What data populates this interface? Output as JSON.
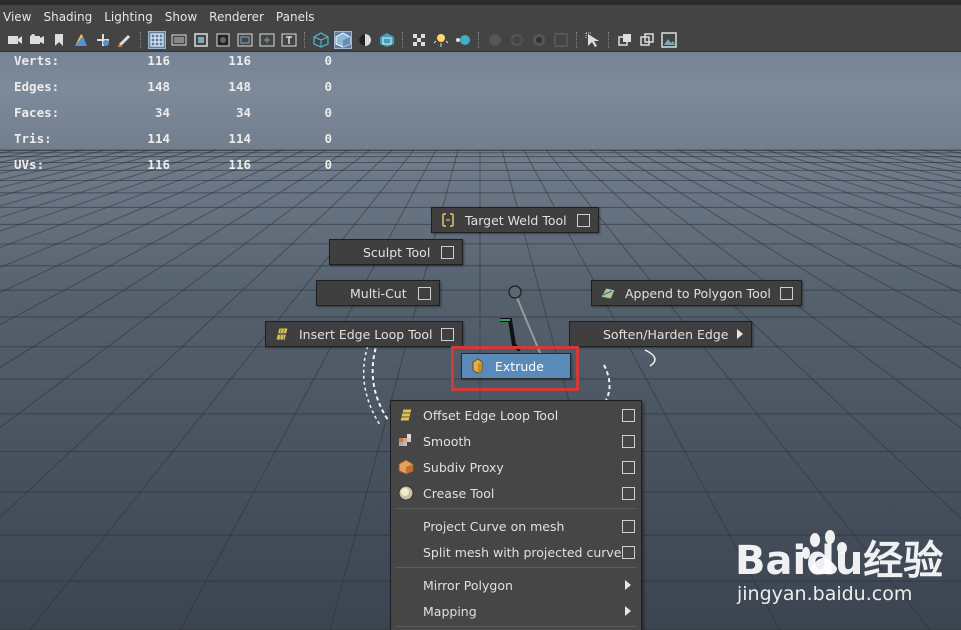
{
  "menubar": {
    "items": [
      "View",
      "Shading",
      "Lighting",
      "Show",
      "Renderer",
      "Panels"
    ]
  },
  "toolbar": {
    "icons": [
      "select-camera-icon",
      "camera-attributes-icon",
      "bookmark-icon",
      "image-plane-icon",
      "2d-pan-zoom-icon",
      "grease-pencil-icon",
      "grid-icon",
      "film-gate-icon",
      "resolution-gate-icon",
      "gate-mask-icon",
      "field-chart-icon",
      "safe-action-icon",
      "safe-title-icon",
      "wireframe-icon",
      "smooth-shade-all-icon",
      "default-material-icon",
      "textured-icon",
      "use-all-lights-icon",
      "shadows-icon",
      "screen-space-ao-icon",
      "motion-blur-icon",
      "anti-aliasing-icon",
      "depth-of-field-icon",
      "isolate-select-icon",
      "xray-icon",
      "xray-joints-icon",
      "backface-culling-icon"
    ]
  },
  "hud": {
    "rows": [
      {
        "label": "Verts:",
        "v1": "116",
        "v2": "116",
        "v3": "0"
      },
      {
        "label": "Edges:",
        "v1": "148",
        "v2": "148",
        "v3": "0"
      },
      {
        "label": "Faces:",
        "v1": "34",
        "v2": "34",
        "v3": "0"
      },
      {
        "label": "Tris:",
        "v1": "114",
        "v2": "114",
        "v3": "0"
      },
      {
        "label": "UVs:",
        "v1": "116",
        "v2": "116",
        "v3": "0"
      }
    ]
  },
  "marking_menu": {
    "north": "Target Weld Tool",
    "northwest_upper": "Sculpt Tool",
    "west": "Multi-Cut",
    "east": "Append to Polygon Tool",
    "southwest": "Insert Edge Loop Tool",
    "southeast": "Soften/Harden Edge",
    "south": "Extrude"
  },
  "dropdown": {
    "group1": [
      "Offset Edge Loop Tool",
      "Smooth",
      "Subdiv Proxy",
      "Crease Tool"
    ],
    "group2": [
      "Project Curve on mesh",
      "Split mesh with projected curve"
    ],
    "group3": [
      "Mirror Polygon",
      "Mapping"
    ]
  },
  "watermark": {
    "brand": "Baidu经验",
    "url": "jingyan.baidu.com"
  },
  "colors": {
    "highlight_border": "#d23a3a",
    "active_item": "#5a8ab8",
    "menu_bg": "#3f3f3f"
  }
}
